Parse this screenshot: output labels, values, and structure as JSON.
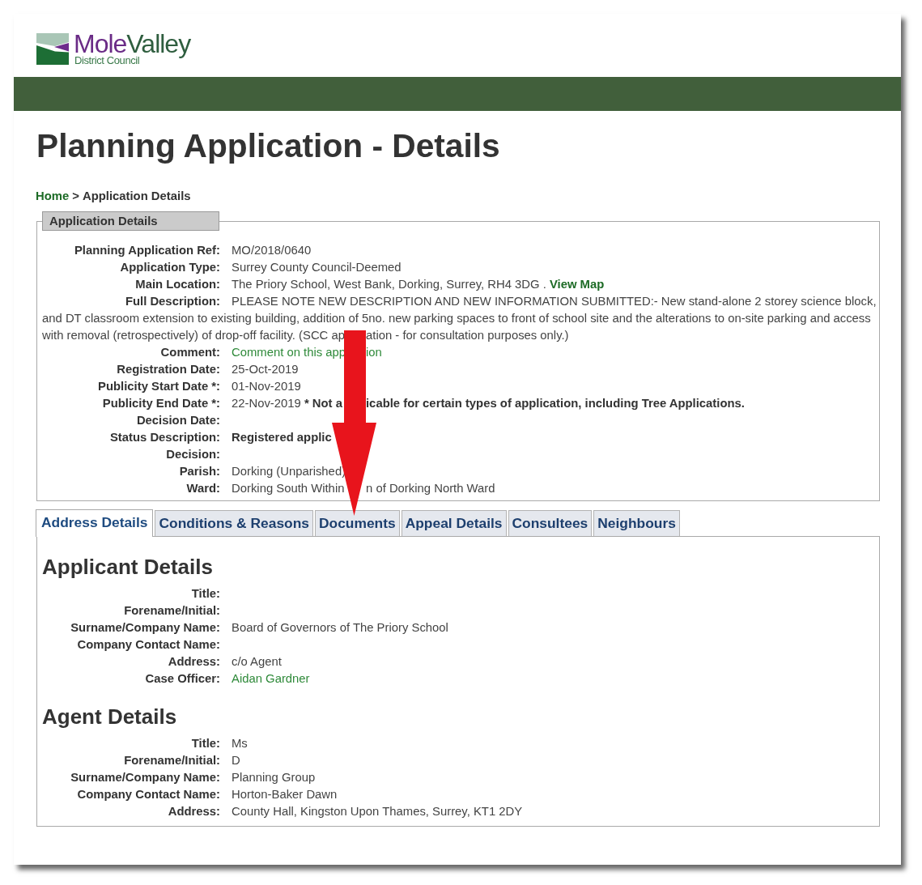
{
  "header": {
    "logo_name": [
      "Mole",
      "Valley"
    ],
    "logo_subtitle": "District Council"
  },
  "page_title": "Planning Application - Details",
  "breadcrumb": {
    "home": "Home",
    "separator": ">",
    "current": "Application Details"
  },
  "application_details": {
    "legend": "Application Details",
    "rows": [
      {
        "label": "Planning Application Ref:",
        "value": [
          {
            "kind": "text",
            "text": "MO/2018/0640"
          }
        ]
      },
      {
        "label": "Application Type:",
        "value": [
          {
            "kind": "text",
            "text": "Surrey County Council-Deemed"
          }
        ]
      },
      {
        "label": "Main Location:",
        "value": [
          {
            "kind": "text",
            "text": "The Priory School, West Bank, Dorking, Surrey, RH4 3DG ."
          },
          {
            "kind": "strong_link",
            "text": "View Map"
          }
        ]
      },
      {
        "label": "Full Description:",
        "lines": [
          "PLEASE NOTE NEW DESCRIPTION AND NEW INFORMATION SUBMITTED:- New stand-alone 2 storey science block,",
          "and DT classroom extension to existing building, addition of 5no. new parking spaces to front of school site and the alterations to on-site parking and access",
          "with removal (retrospectively) of drop-off facility. (SCC ap"
        ],
        "after_arrow": [
          {
            "kind": "text",
            "text": "ation - for consultation purposes only.)"
          }
        ]
      },
      {
        "label": "Comment:",
        "value": [
          {
            "kind": "link",
            "text": "Comment on this app"
          }
        ],
        "after_arrow": [
          {
            "kind": "link",
            "text": "ion"
          }
        ]
      },
      {
        "label": "Registration Date:",
        "value": [
          {
            "kind": "text",
            "text": "25-Oct-2019"
          }
        ]
      },
      {
        "label": "Publicity Start Date *:",
        "value": [
          {
            "kind": "text",
            "text": "01-Nov-2019"
          }
        ]
      },
      {
        "label": "Publicity End Date *:",
        "value": [
          {
            "kind": "text",
            "text": "22-Nov-2019"
          },
          {
            "kind": "note",
            "text": "* Not a"
          }
        ],
        "after_arrow": [
          {
            "kind": "note",
            "text": "icable for certain types of application, including Tree Applications."
          }
        ]
      },
      {
        "label": "Decision Date:"
      },
      {
        "label": "Status Description:",
        "value": [
          {
            "kind": "strong",
            "text": "Registered applic"
          }
        ]
      },
      {
        "label": "Decision:"
      },
      {
        "label": "Parish:",
        "value": [
          {
            "kind": "text",
            "text": "Dorking (Unparished)"
          }
        ]
      },
      {
        "label": "Ward:",
        "value": [
          {
            "kind": "text",
            "text": "Dorking South Within"
          }
        ],
        "after_arrow": [
          {
            "kind": "text",
            "text": "n of Dorking North Ward"
          }
        ]
      }
    ]
  },
  "tabs": [
    {
      "label": "Address Details",
      "selected": true
    },
    {
      "label": "Conditions & Reasons",
      "selected": false
    },
    {
      "label": "Documents",
      "selected": false
    },
    {
      "label": "Appeal Details",
      "selected": false
    },
    {
      "label": "Consultees",
      "selected": false
    },
    {
      "label": "Neighbours",
      "selected": false
    }
  ],
  "sections": [
    {
      "heading": "Applicant Details",
      "rows": [
        {
          "label": "Title:"
        },
        {
          "label": "Forename/Initial:"
        },
        {
          "label": "Surname/Company Name:",
          "value": "Board of Governors of The Priory School",
          "kind": "text"
        },
        {
          "label": "Company Contact Name:"
        },
        {
          "label": "Address:",
          "value": "c/o Agent",
          "kind": "text"
        },
        {
          "label": "Case Officer:",
          "value": "Aidan Gardner",
          "kind": "link"
        }
      ]
    },
    {
      "heading": "Agent Details",
      "rows": [
        {
          "label": "Title:",
          "value": "Ms",
          "kind": "text"
        },
        {
          "label": "Forename/Initial:",
          "value": "D",
          "kind": "text"
        },
        {
          "label": "Surname/Company Name:",
          "value": "Planning Group",
          "kind": "text"
        },
        {
          "label": "Company Contact Name:",
          "value": "Horton-Baker Dawn",
          "kind": "text"
        },
        {
          "label": "Address:",
          "value": "County Hall, Kingston Upon Thames, Surrey, KT1 2DY",
          "kind": "text"
        }
      ]
    }
  ]
}
